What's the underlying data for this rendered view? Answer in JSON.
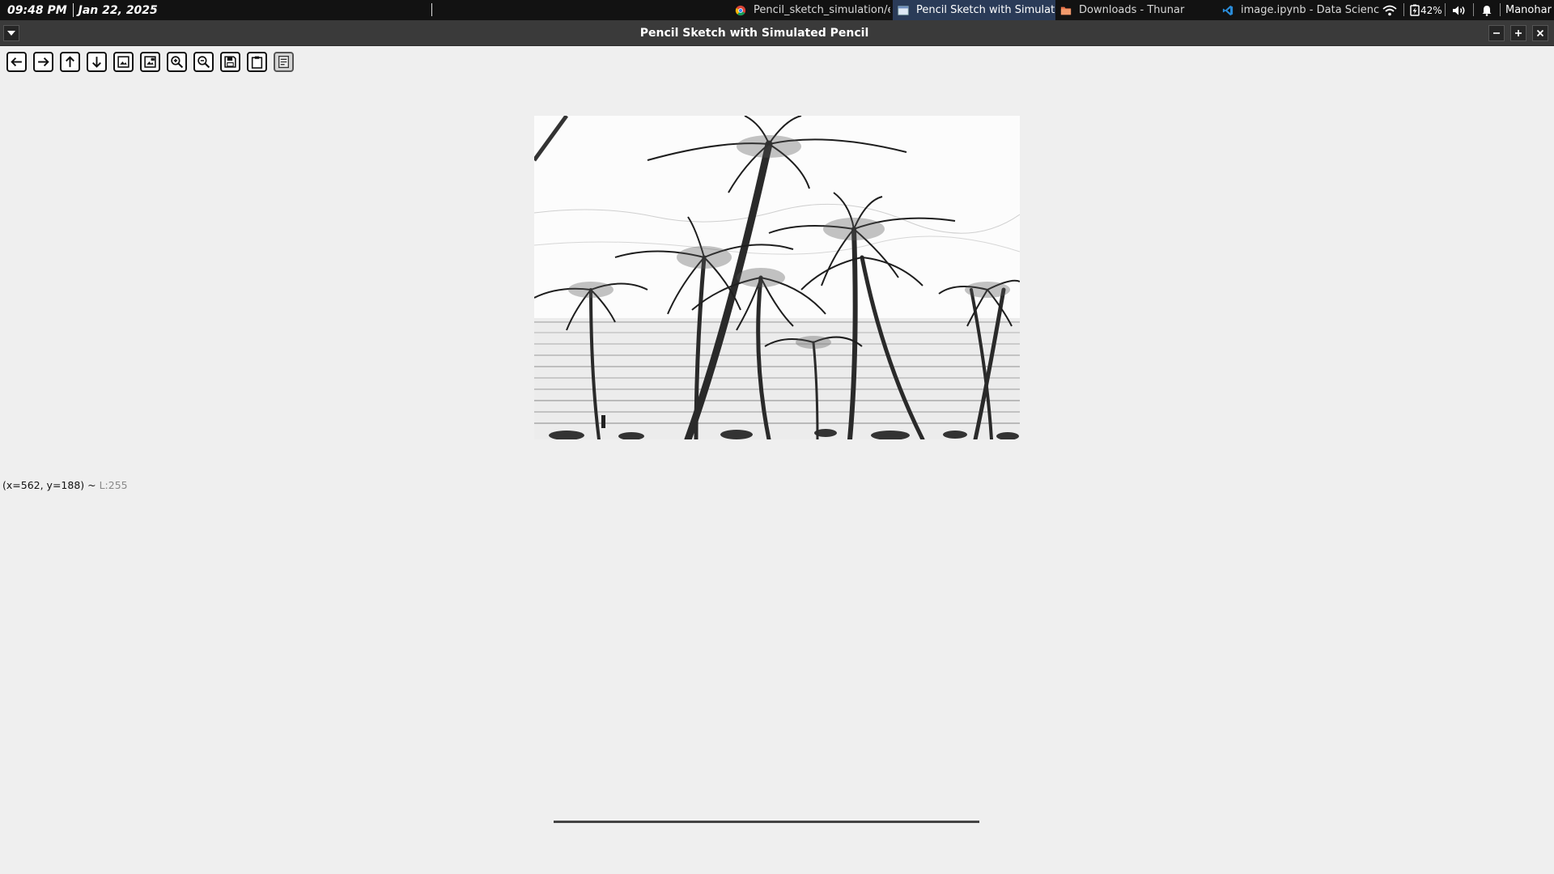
{
  "panel": {
    "time": "09:48 PM",
    "date": "Jan 22, 2025",
    "tasks": [
      {
        "label": "Pencil_sketch_simulation/ex...",
        "icon": "chrome-icon",
        "active": false
      },
      {
        "label": "Pencil Sketch with Simulated...",
        "icon": "window-icon",
        "active": true
      },
      {
        "label": "Downloads - Thunar",
        "icon": "folder-icon",
        "active": false
      },
      {
        "label": "image.ipynb - Data Science -...",
        "icon": "vscode-icon",
        "active": false
      }
    ],
    "battery": "42%",
    "user": "Manohar"
  },
  "window": {
    "title": "Pencil Sketch with Simulated Pencil"
  },
  "toolbar": {
    "buttons": [
      "pan-left",
      "pan-right",
      "pan-up",
      "pan-down",
      "zoom-in-rect",
      "zoom-out-rect",
      "zoom-in",
      "zoom-out",
      "save-image",
      "copy-clipboard",
      "properties"
    ]
  },
  "status": {
    "coords": "(x=562, y=188) ~",
    "value": "L:255"
  },
  "colors": {
    "panel_bg": "#121212",
    "active_task": "#2a3b58",
    "titlebar_bg": "#3a3a3a",
    "content_bg": "#efefef"
  }
}
